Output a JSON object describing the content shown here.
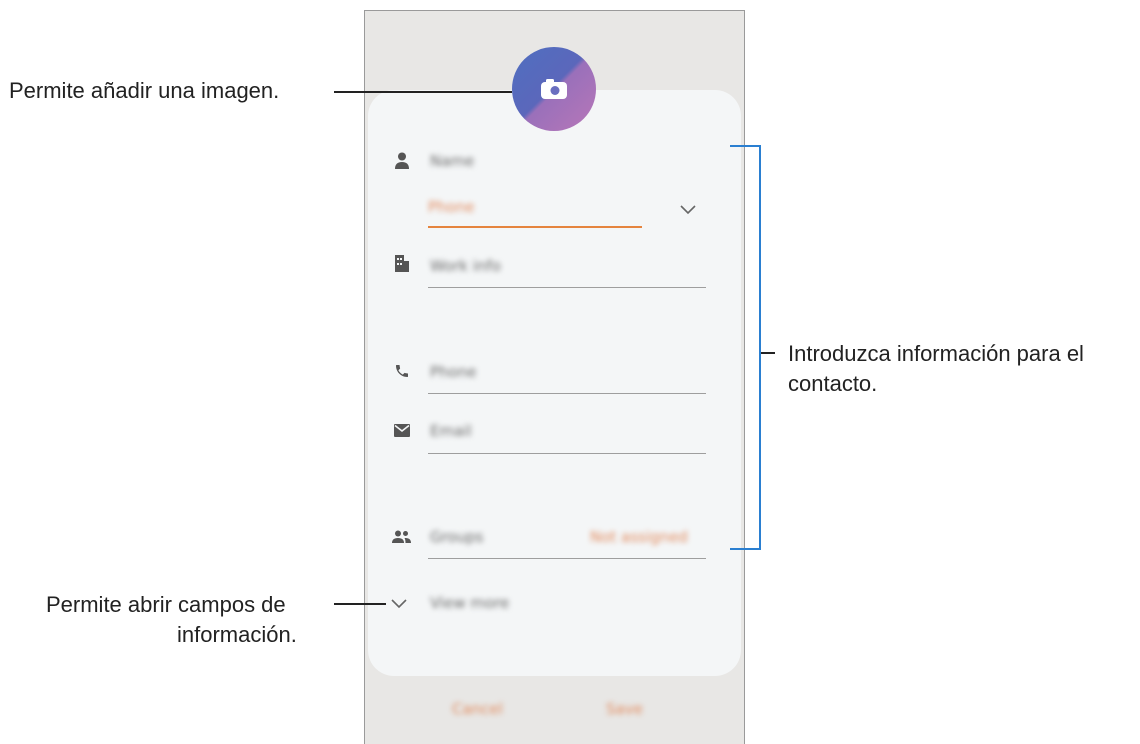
{
  "form": {
    "name_placeholder": "Name",
    "account_placeholder": "Phone",
    "company_placeholder": "Work info",
    "phone_placeholder": "Phone",
    "email_placeholder": "Email",
    "groups_label": "Groups",
    "groups_value": "Not assigned",
    "view_more_label": "View more",
    "cancel_label": "Cancel",
    "save_label": "Save"
  },
  "callouts": {
    "add_image": "Permite añadir una imagen.",
    "contact_info_line1": "Introduzca información para el",
    "contact_info_line2": "contacto.",
    "open_fields_line1": "Permite abrir campos de",
    "open_fields_line2": "información."
  },
  "colors": {
    "accent_orange": "#e5843e",
    "bracket_blue": "#2a7fd1",
    "avatar_gradient": [
      "#4f6fc0",
      "#b877b8"
    ]
  }
}
